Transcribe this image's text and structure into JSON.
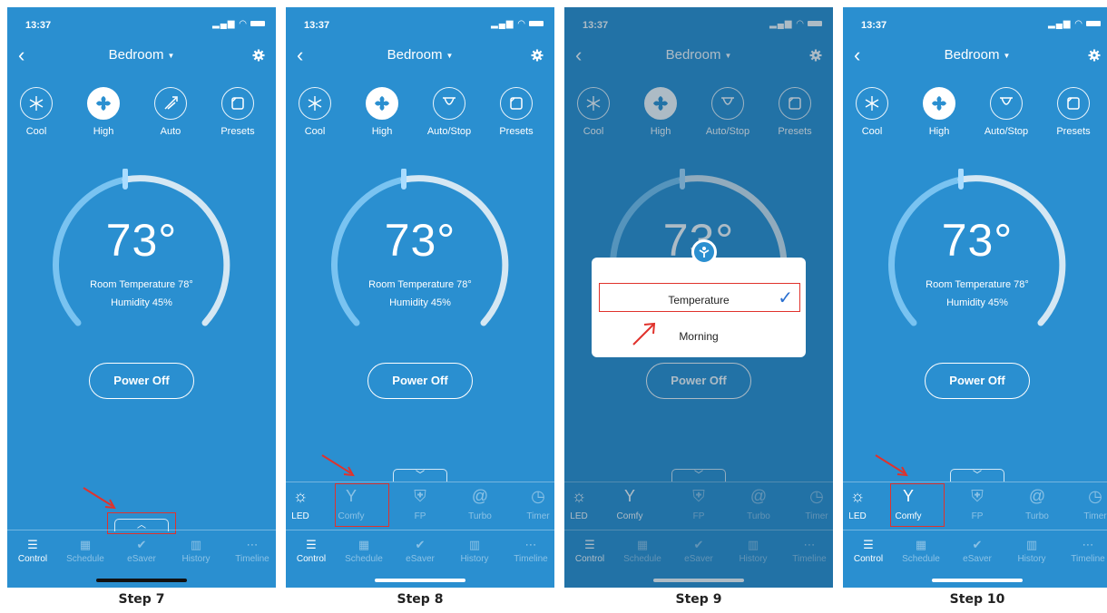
{
  "colors": {
    "background": "#2a8fd0",
    "highlight": "#e0322c",
    "check": "#2a6fd0"
  },
  "status": {
    "time": "13:37"
  },
  "header": {
    "room": "Bedroom"
  },
  "icons": {
    "back": "chevron-left-icon",
    "gear": "gear-icon",
    "cool": "snowflake-icon",
    "fan": "fan-icon",
    "swing": "swing-icon",
    "presets": "presets-icon",
    "led": "lightbulb-icon",
    "comfy": "person-icon",
    "fp": "shield-icon",
    "turbo": "spiral-icon",
    "timer": "timer-icon",
    "control": "sliders-icon",
    "schedule": "calendar-icon",
    "esaver": "leaf-icon",
    "history": "bar-chart-icon",
    "timeline": "timeline-icon",
    "tray_up": "chevron-up-icon",
    "tray_down": "chevron-down-icon"
  },
  "screens": [
    {
      "step": "Step 7",
      "modes": [
        "Cool",
        "High",
        "Auto",
        "Presets"
      ]
    },
    {
      "step": "Step 8",
      "modes": [
        "Cool",
        "High",
        "Auto/Stop",
        "Presets"
      ]
    },
    {
      "step": "Step 9",
      "modes": [
        "Cool",
        "High",
        "Auto/Stop",
        "Presets"
      ]
    },
    {
      "step": "Step 10",
      "modes": [
        "Cool",
        "High",
        "Auto/Stop",
        "Presets"
      ]
    }
  ],
  "dial": {
    "temperature": "73°",
    "room_temperature": "Room Temperature 78°",
    "humidity": "Humidity 45%"
  },
  "power_label": "Power Off",
  "tray": [
    "LED",
    "Comfy",
    "FP",
    "Turbo",
    "Timer"
  ],
  "nav": [
    "Control",
    "Schedule",
    "eSaver",
    "History",
    "Timeline"
  ],
  "popup": {
    "option1": "Temperature",
    "option2": "Morning"
  }
}
